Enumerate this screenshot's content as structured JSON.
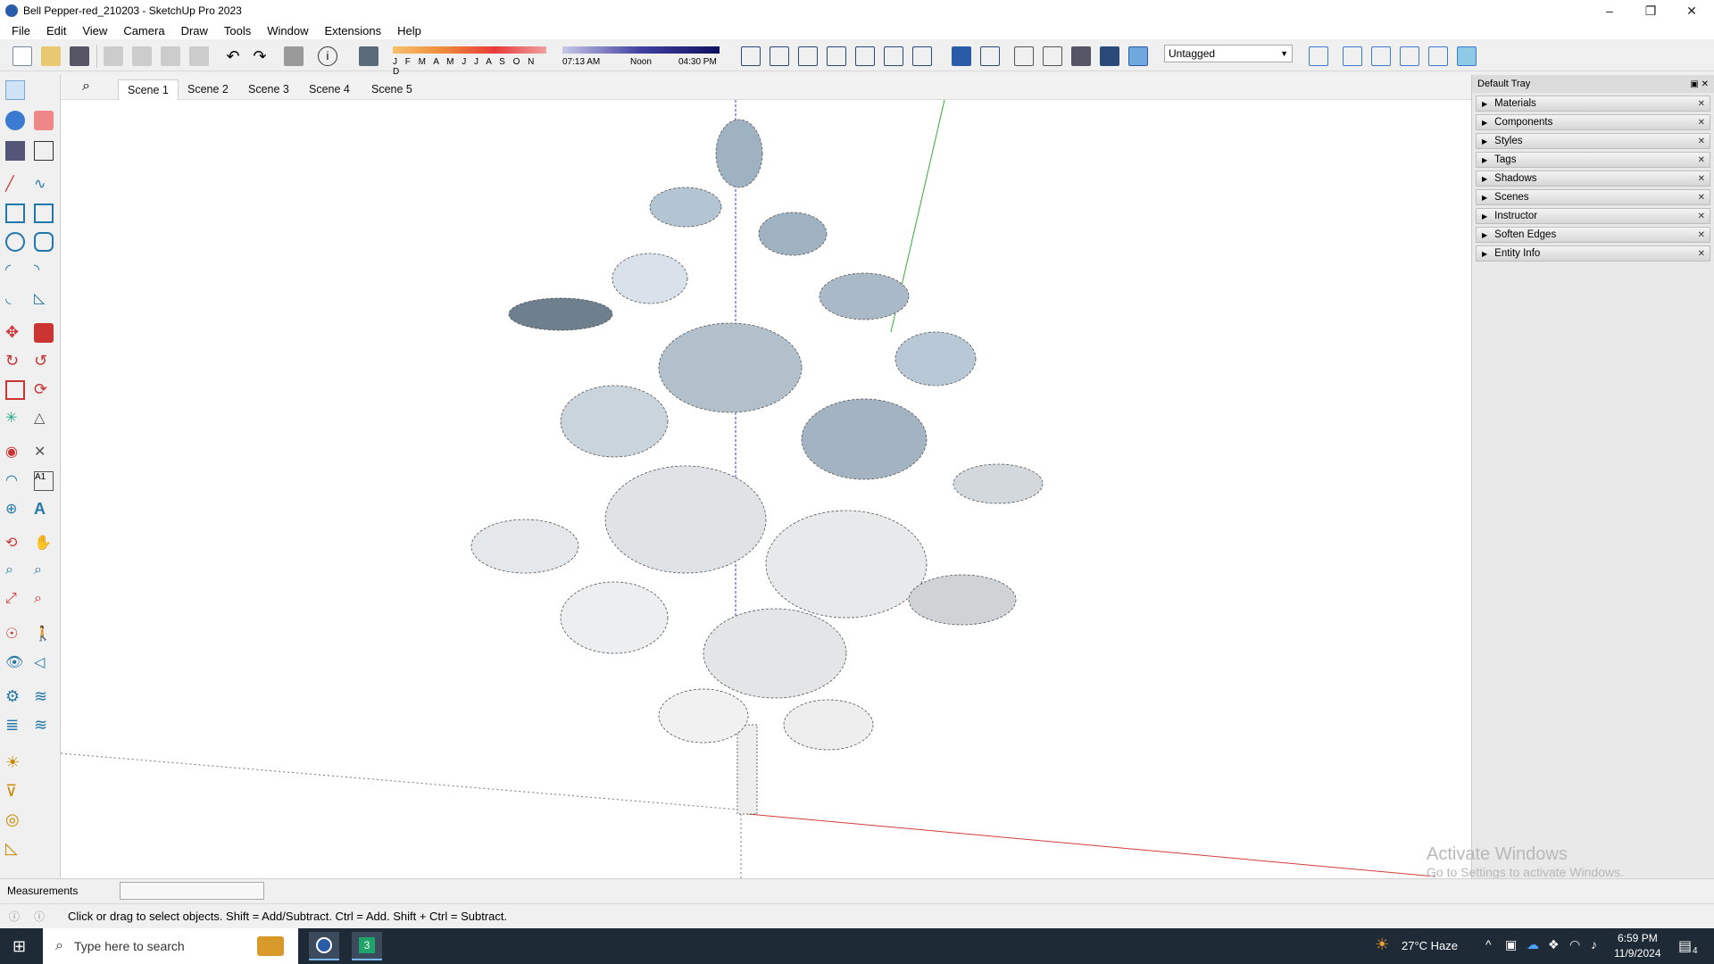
{
  "window": {
    "title": "Bell Pepper-red_210203 - SketchUp Pro 2023",
    "minimize": "–",
    "maximize": "❐",
    "close": "✕"
  },
  "menu": [
    "File",
    "Edit",
    "View",
    "Camera",
    "Draw",
    "Tools",
    "Window",
    "Extensions",
    "Help"
  ],
  "shadow": {
    "months": "J F M A M J J A S O N D",
    "time": "07:13 AM",
    "noon": "Noon",
    "end_time": "04:30 PM"
  },
  "tag_select": {
    "value": "Untagged"
  },
  "scenes": [
    "Scene 1",
    "Scene 2",
    "Scene 3",
    "Scene 4",
    "Scene 5"
  ],
  "tray": {
    "title": "Default Tray",
    "items": [
      "Materials",
      "Components",
      "Styles",
      "Tags",
      "Shadows",
      "Scenes",
      "Instructor",
      "Soften Edges",
      "Entity Info"
    ]
  },
  "measurements": {
    "label": "Measurements",
    "value": ""
  },
  "status": {
    "text": "Click or drag to select objects. Shift = Add/Subtract. Ctrl = Add. Shift + Ctrl = Subtract."
  },
  "watermark": {
    "line1": "Activate Windows",
    "line2": "Go to Settings to activate Windows."
  },
  "taskbar": {
    "search_placeholder": "Type here to search",
    "weather": "27°C  Haze",
    "time": "6:59 PM",
    "date": "11/9/2024",
    "notif_count": "4"
  },
  "colors": {
    "accent": "#0078d4",
    "axis_red": "#d23a3a",
    "axis_green": "#3aa83a",
    "axis_blue": "#3a3ad2"
  }
}
